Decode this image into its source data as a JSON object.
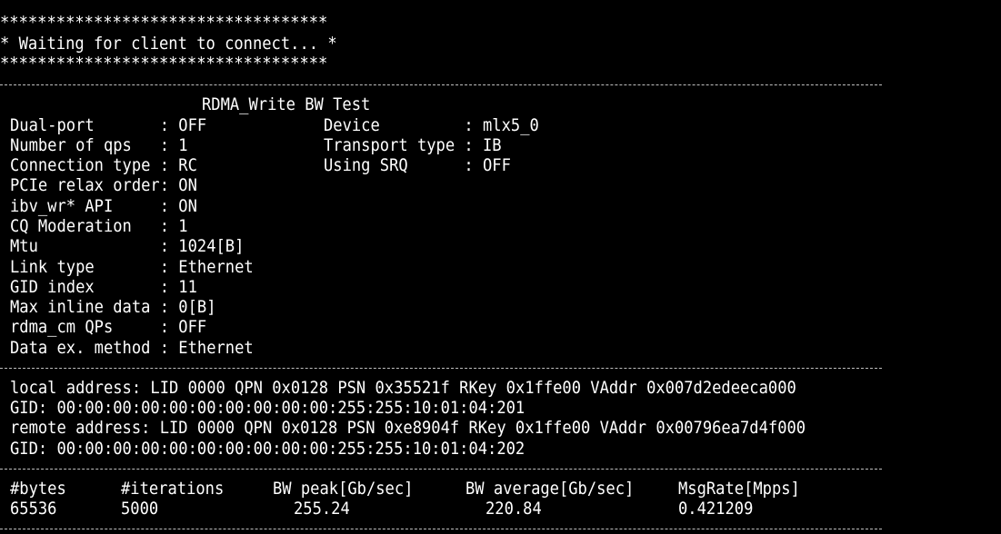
{
  "terminal": {
    "banner": [
      "***********************************",
      "* Waiting for client to connect... *",
      "***********************************"
    ],
    "test_title": "RDMA_Write BW Test",
    "left_params": [
      "Dual-port       : OFF",
      "Number of qps   : 1",
      "Connection type : RC",
      "PCIe relax order: ON",
      "ibv_wr* API     : ON",
      "CQ Moderation   : 1",
      "Mtu             : 1024[B]",
      "Link type       : Ethernet",
      "GID index       : 11",
      "Max inline data : 0[B]",
      "rdma_cm QPs     : OFF",
      "Data ex. method : Ethernet"
    ],
    "right_params": [
      "Device         : mlx5_0",
      "Transport type : IB",
      "Using SRQ      : OFF"
    ],
    "addresses": [
      "local address: LID 0000 QPN 0x0128 PSN 0x35521f RKey 0x1ffe00 VAddr 0x007d2edeeca000",
      "GID: 00:00:00:00:00:00:00:00:00:00:255:255:10:01:04:201",
      "remote address: LID 0000 QPN 0x0128 PSN 0xe8904f RKey 0x1ffe00 VAddr 0x00796ea7d4f000",
      "GID: 00:00:00:00:00:00:00:00:00:00:255:255:10:01:04:202"
    ],
    "results": {
      "headers": [
        "#bytes",
        "#iterations",
        "BW peak[Gb/sec]",
        "BW average[Gb/sec]",
        "MsgRate[Mpps]"
      ],
      "values": [
        "65536",
        "5000",
        "255.24",
        "220.84",
        "0.421209"
      ]
    }
  }
}
